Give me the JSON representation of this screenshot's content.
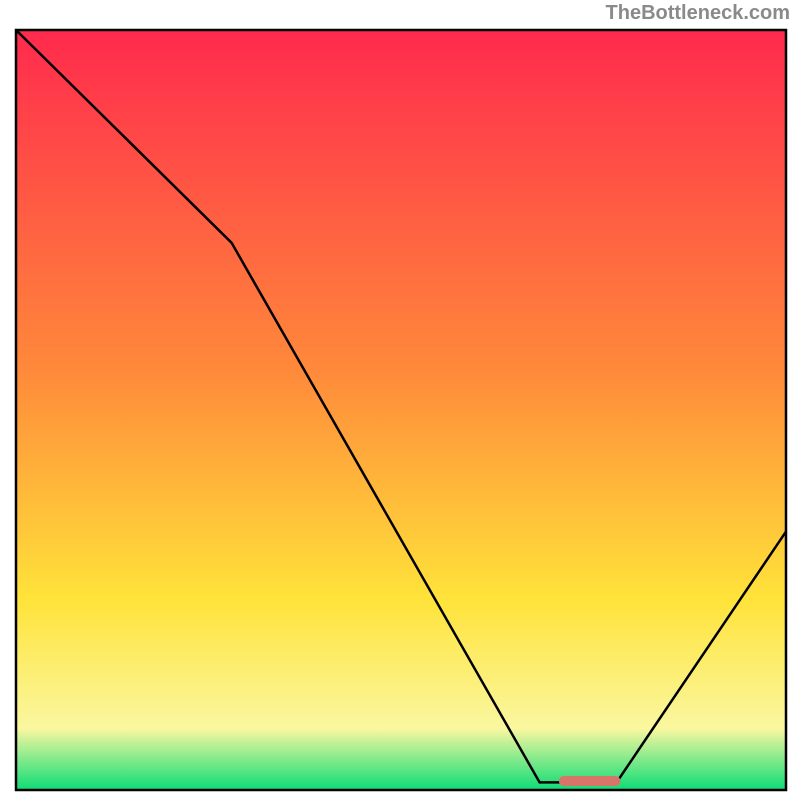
{
  "watermark": "TheBottleneck.com",
  "colors": {
    "red": "#ff2a4d",
    "orange": "#ff8a3a",
    "yellow": "#ffe33a",
    "pale_yellow": "#faf7a0",
    "green": "#11dd77",
    "curve": "#000000",
    "marker": "#d9746b",
    "frame": "#000000"
  },
  "layout": {
    "frame_left": 16,
    "frame_top": 30,
    "frame_width": 770,
    "frame_height": 760,
    "marker_left_frac": 0.705,
    "marker_width_frac": 0.08,
    "marker_bottom_inset": 4
  },
  "chart_data": {
    "type": "line",
    "title": "",
    "xlabel": "",
    "ylabel": "",
    "xlim": [
      0,
      1
    ],
    "ylim": [
      0,
      1
    ],
    "x": [
      0.0,
      0.28,
      0.68,
      0.78,
      1.0
    ],
    "y": [
      1.0,
      0.72,
      0.01,
      0.01,
      0.34
    ],
    "annotations": {
      "watermark": "TheBottleneck.com"
    },
    "marker": {
      "x_start": 0.705,
      "x_end": 0.785,
      "y": 0.005
    },
    "background_gradient_stops": [
      {
        "pos": 0.0,
        "color": "#ff2a4d"
      },
      {
        "pos": 0.45,
        "color": "#ff8a3a"
      },
      {
        "pos": 0.75,
        "color": "#ffe33a"
      },
      {
        "pos": 0.92,
        "color": "#faf7a0"
      },
      {
        "pos": 1.0,
        "color": "#11dd77"
      }
    ]
  }
}
